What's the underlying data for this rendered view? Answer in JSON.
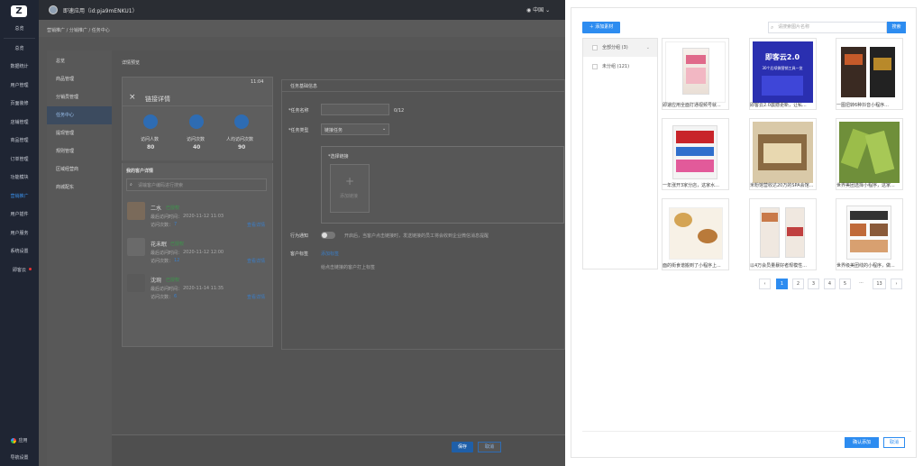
{
  "app": {
    "title": "即速应用（id:pja9mENKU1）",
    "region": "中国"
  },
  "sidebar": {
    "logo": "Z",
    "items": [
      "总览",
      "总览",
      "数据统计",
      "用户管理",
      "页面装修",
      "店铺管理",
      "商品管理",
      "订单管理",
      "功能模块",
      "营销推广",
      "用户插件",
      "用户服务",
      "系统设置",
      "即客云"
    ],
    "active_index": 9,
    "bottom": [
      "应用",
      "导航设置"
    ]
  },
  "breadcrumb": "营销推广 / 分销推广 / 任务中心",
  "subnav": {
    "items": [
      "总览",
      "商品管理",
      "分销员管理",
      "任务中心",
      "提现管理",
      "规则管理",
      "区域经营商",
      "商城配东"
    ],
    "active_index": 3
  },
  "preview": {
    "section_title": "详情预览",
    "phone_time": "11:04",
    "header": "链接详情",
    "stats": [
      {
        "label": "访问人数",
        "value": "80"
      },
      {
        "label": "访问次数",
        "value": "40"
      },
      {
        "label": "人均访问次数",
        "value": "90"
      }
    ],
    "customers_title": "我的客户详情",
    "search_placeholder": "请输客户编码进行搜索",
    "customers": [
      {
        "name": "二水",
        "tag": "已授权",
        "time_label": "最后访问时间：",
        "time": "2020-11-12  11:03",
        "count_label": "访问次数：",
        "count": "7",
        "link": "查看详情"
      },
      {
        "name": "花未眠",
        "tag": "已授权",
        "time_label": "最后访问时间：",
        "time": "2020-11-12  12:00",
        "count_label": "访问次数：",
        "count": "12",
        "link": "查看详情"
      },
      {
        "name": "沈琬",
        "tag": "已授权",
        "time_label": "最后访问时间：",
        "time": "2020-11-14  11:35",
        "count_label": "访问次数：",
        "count": "6",
        "link": "查看详情"
      }
    ]
  },
  "form": {
    "panel_title": "任务基础信息",
    "name_label": "*任务名称",
    "name_counter": "0/12",
    "type_label": "*任务类型",
    "type_value": "链接任务",
    "link_label": "*选择链接",
    "upload_label": "添加链接",
    "behavior_label": "行为通知",
    "behavior_text": "开启后，当客户点击链接时，发送链接的员工将会收到企业微信消息提醒",
    "customer_tag_label": "客户标签",
    "customer_tag_link": "添加标签",
    "customer_tag_hint": "给点击链接的客户打上标签"
  },
  "footer": {
    "save": "保存",
    "cancel": "取消"
  },
  "picker": {
    "add_button": "添加素材",
    "search_placeholder": "请搜索图片名称",
    "search_button": "搜索",
    "groups": [
      {
        "label": "全部分组",
        "count": "(3)"
      },
      {
        "label": "未分组",
        "count": "(121)"
      }
    ],
    "items": [
      {
        "caption": "即速应用全面打通视频号就..."
      },
      {
        "caption": "即客云2.0震撼更新，让私..."
      },
      {
        "caption": "一图扭转6种抖音小程序..."
      },
      {
        "caption": "一年涨开3家分店，这家水..."
      },
      {
        "caption": "米粉馆营收达20万的SPA会馆..."
      },
      {
        "caption": "世界美团选择小程序，这家..."
      },
      {
        "caption": "面的街食谱搬到了小程序上..."
      },
      {
        "caption": "以4万会员量暴好者规模性..."
      },
      {
        "caption": "世界级美团线的小程序，做..."
      }
    ],
    "thumb_texts": {
      "jikeyun_title": "即客云2.0",
      "jikeyun_sub": "30个后续微营销工具一览"
    },
    "pagination": {
      "prev": "‹",
      "pages": [
        "1",
        "2",
        "3",
        "4",
        "5"
      ],
      "ellipsis": "···",
      "last": "13",
      "next": "›",
      "current": "1"
    },
    "confirm": "确认添加",
    "cancel": "取消"
  },
  "colors": {
    "accent": "#2d8cf0",
    "sidebar_bg": "#1f2533"
  }
}
